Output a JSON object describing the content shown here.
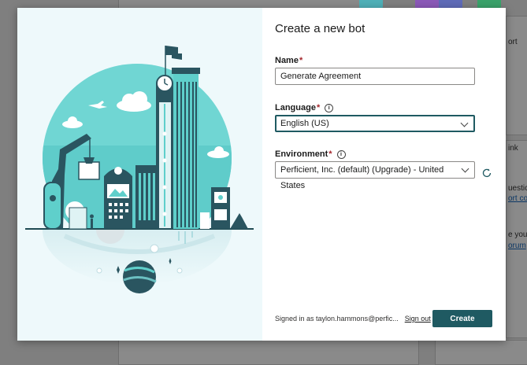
{
  "background": {
    "snippets": [
      "ort",
      "ink",
      "uestic",
      "ort co",
      "e your",
      "orum"
    ]
  },
  "dialog": {
    "title": "Create a new bot",
    "name_label": "Name",
    "name_value": "Generate Agreement",
    "language_label": "Language",
    "language_value": "English (US)",
    "environment_label": "Environment",
    "environment_value": "Perficient, Inc. (default) (Upgrade) - United States",
    "required_marker": "*",
    "info_glyph": "i",
    "signed_in_text": "Signed in as taylon.hammons@perfic...",
    "sign_out_label": "Sign out",
    "create_label": "Create",
    "colors": {
      "primary": "#1f5a62",
      "required": "#a4262c",
      "illustration_bg": "#eef9fb",
      "teal": "#5fd3d1"
    }
  }
}
